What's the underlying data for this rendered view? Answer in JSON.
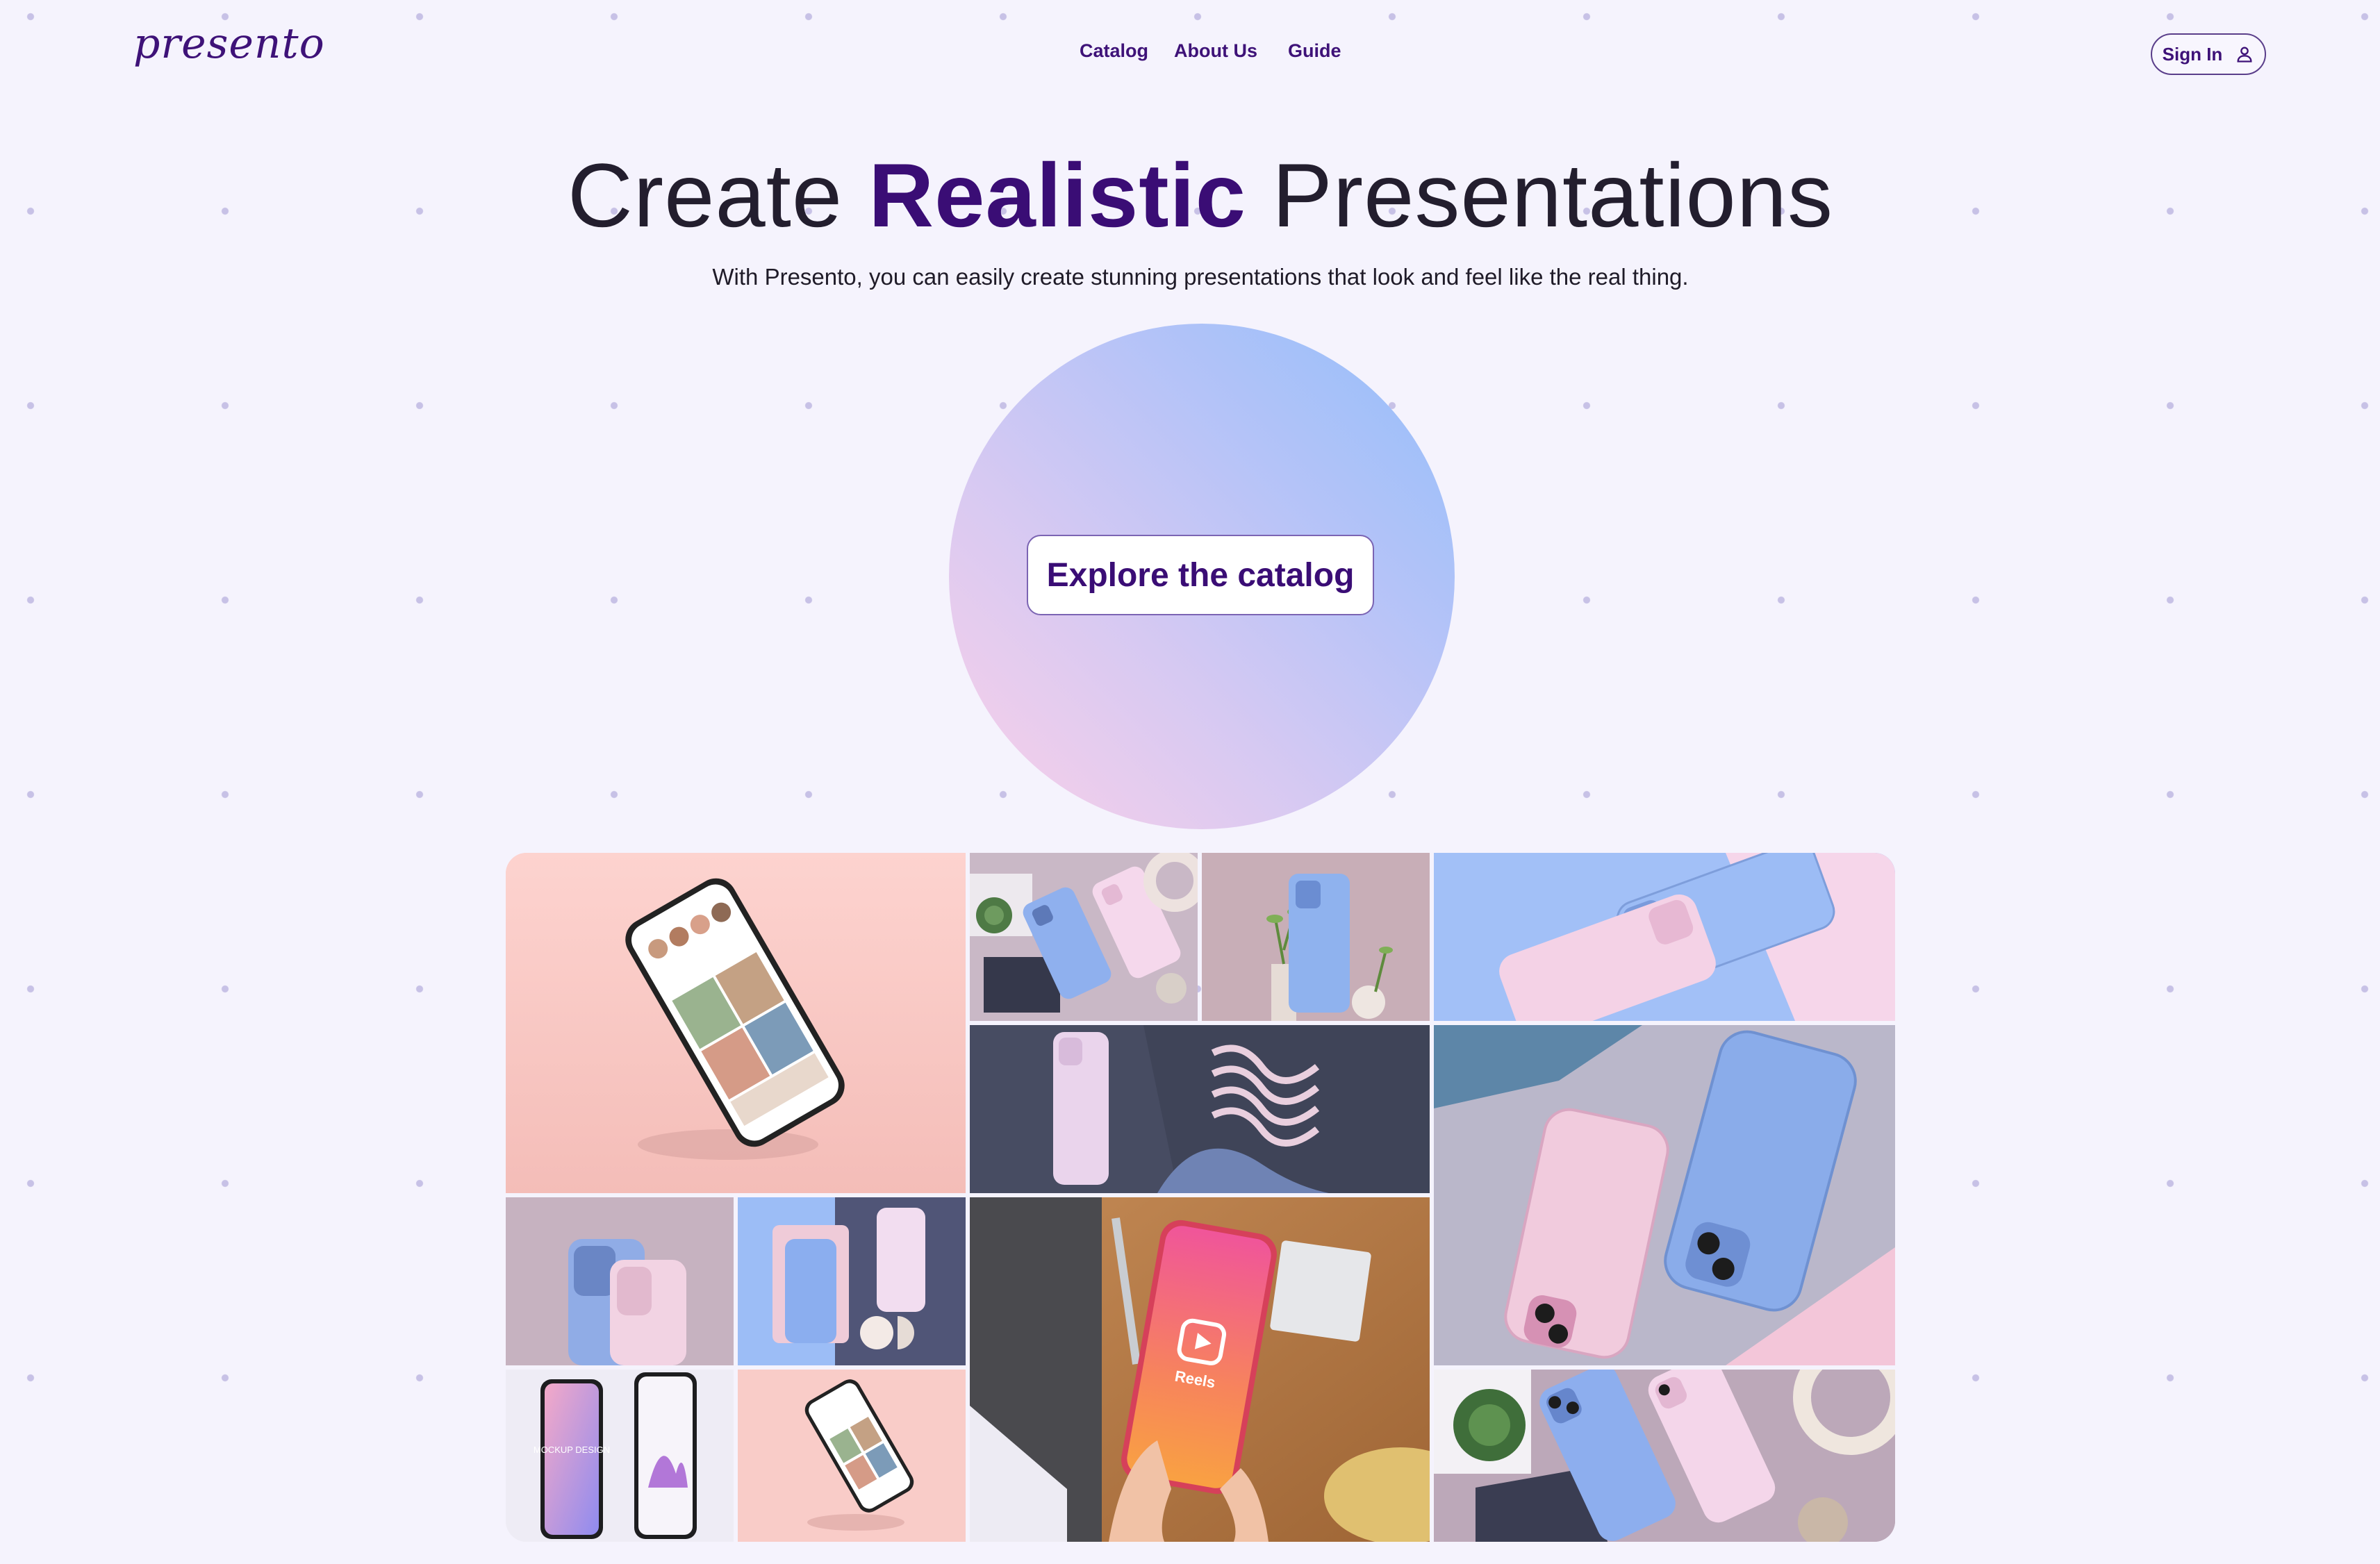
{
  "brand": {
    "logo_text": "presento"
  },
  "nav": {
    "items": [
      "Catalog",
      "About Us",
      "Guide"
    ]
  },
  "header": {
    "signin_label": "Sign In"
  },
  "hero": {
    "title_prefix": "Create",
    "title_accent": "Realistic",
    "title_suffix": "Presentations",
    "subtitle": "With Presento, you can easily create stunning presentations that look and feel like the real thing.",
    "cta_label": "Explore the catalog"
  },
  "gallery": {
    "tiles": [
      "floating-phone-pink-mockup",
      "phones-with-succulent-mockup",
      "blue-phone-with-plants-mockup",
      "blue-and-pink-phones-flatlay",
      "pink-phone-wave-tray-mockup",
      "large-pink-and-blue-phones-flatlay",
      "phone-back-cameras-mockup",
      "phones-on-wave-stand-mockup",
      "hands-holding-phone-reels-mockup",
      "two-phones-mockup-design-screens",
      "small-floating-phone-mockup",
      "phones-with-plant-and-ring-mockup"
    ],
    "screen_texts": {
      "reels_label": "Reels",
      "mockup_label": "MOCKUP DESIGN"
    }
  },
  "colors": {
    "background": "#F5F3FD",
    "accent": "#3A0D75",
    "dot": "#C7C1E6"
  }
}
